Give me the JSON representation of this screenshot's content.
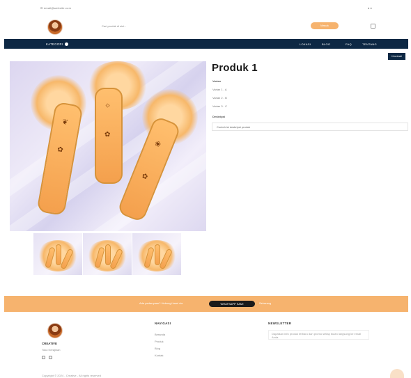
{
  "topbar": {
    "contact": "✉ email@website.com",
    "right": "● ●"
  },
  "header": {
    "search_placeholder": "Cari produk di sini...",
    "button_label": "Masuk"
  },
  "navbar": {
    "category_label": "KATEGORI",
    "items": [
      {
        "label": "LOKASI"
      },
      {
        "label": "BLOG"
      },
      {
        "label": "FAQ"
      },
      {
        "label": "TENTANG"
      }
    ]
  },
  "back_button": "Kembali",
  "product": {
    "title": "Produk 1",
    "options_label": "Varian",
    "variants": [
      "Varian 1 - A",
      "Varian 2 - B",
      "Varian 3 - C"
    ],
    "description_label": "Deskripsi",
    "description": "Contoh isi deskripsi produk"
  },
  "banner": {
    "text_left": "Ada pertanyaan? Hubungi kami via",
    "button_label": "WHATSAPP KAMI",
    "text_right": "Sekarang"
  },
  "footer": {
    "brand": "CREATIVE",
    "tagline": "Toko Kerajinan",
    "nav_heading": "NAVIGASI",
    "nav_links": [
      "Beranda",
      "Produk",
      "Blog",
      "Kontak"
    ],
    "newsletter_heading": "NEWSLETTER",
    "newsletter_text": "Dapatkan info produk terbaru dan promo setiap bulan langsung ke email Anda.",
    "copyright": "Copyright © 2024 - Creative - All rights reserved"
  },
  "colors": {
    "navy": "#0d2844",
    "accent": "#f6b36e"
  }
}
